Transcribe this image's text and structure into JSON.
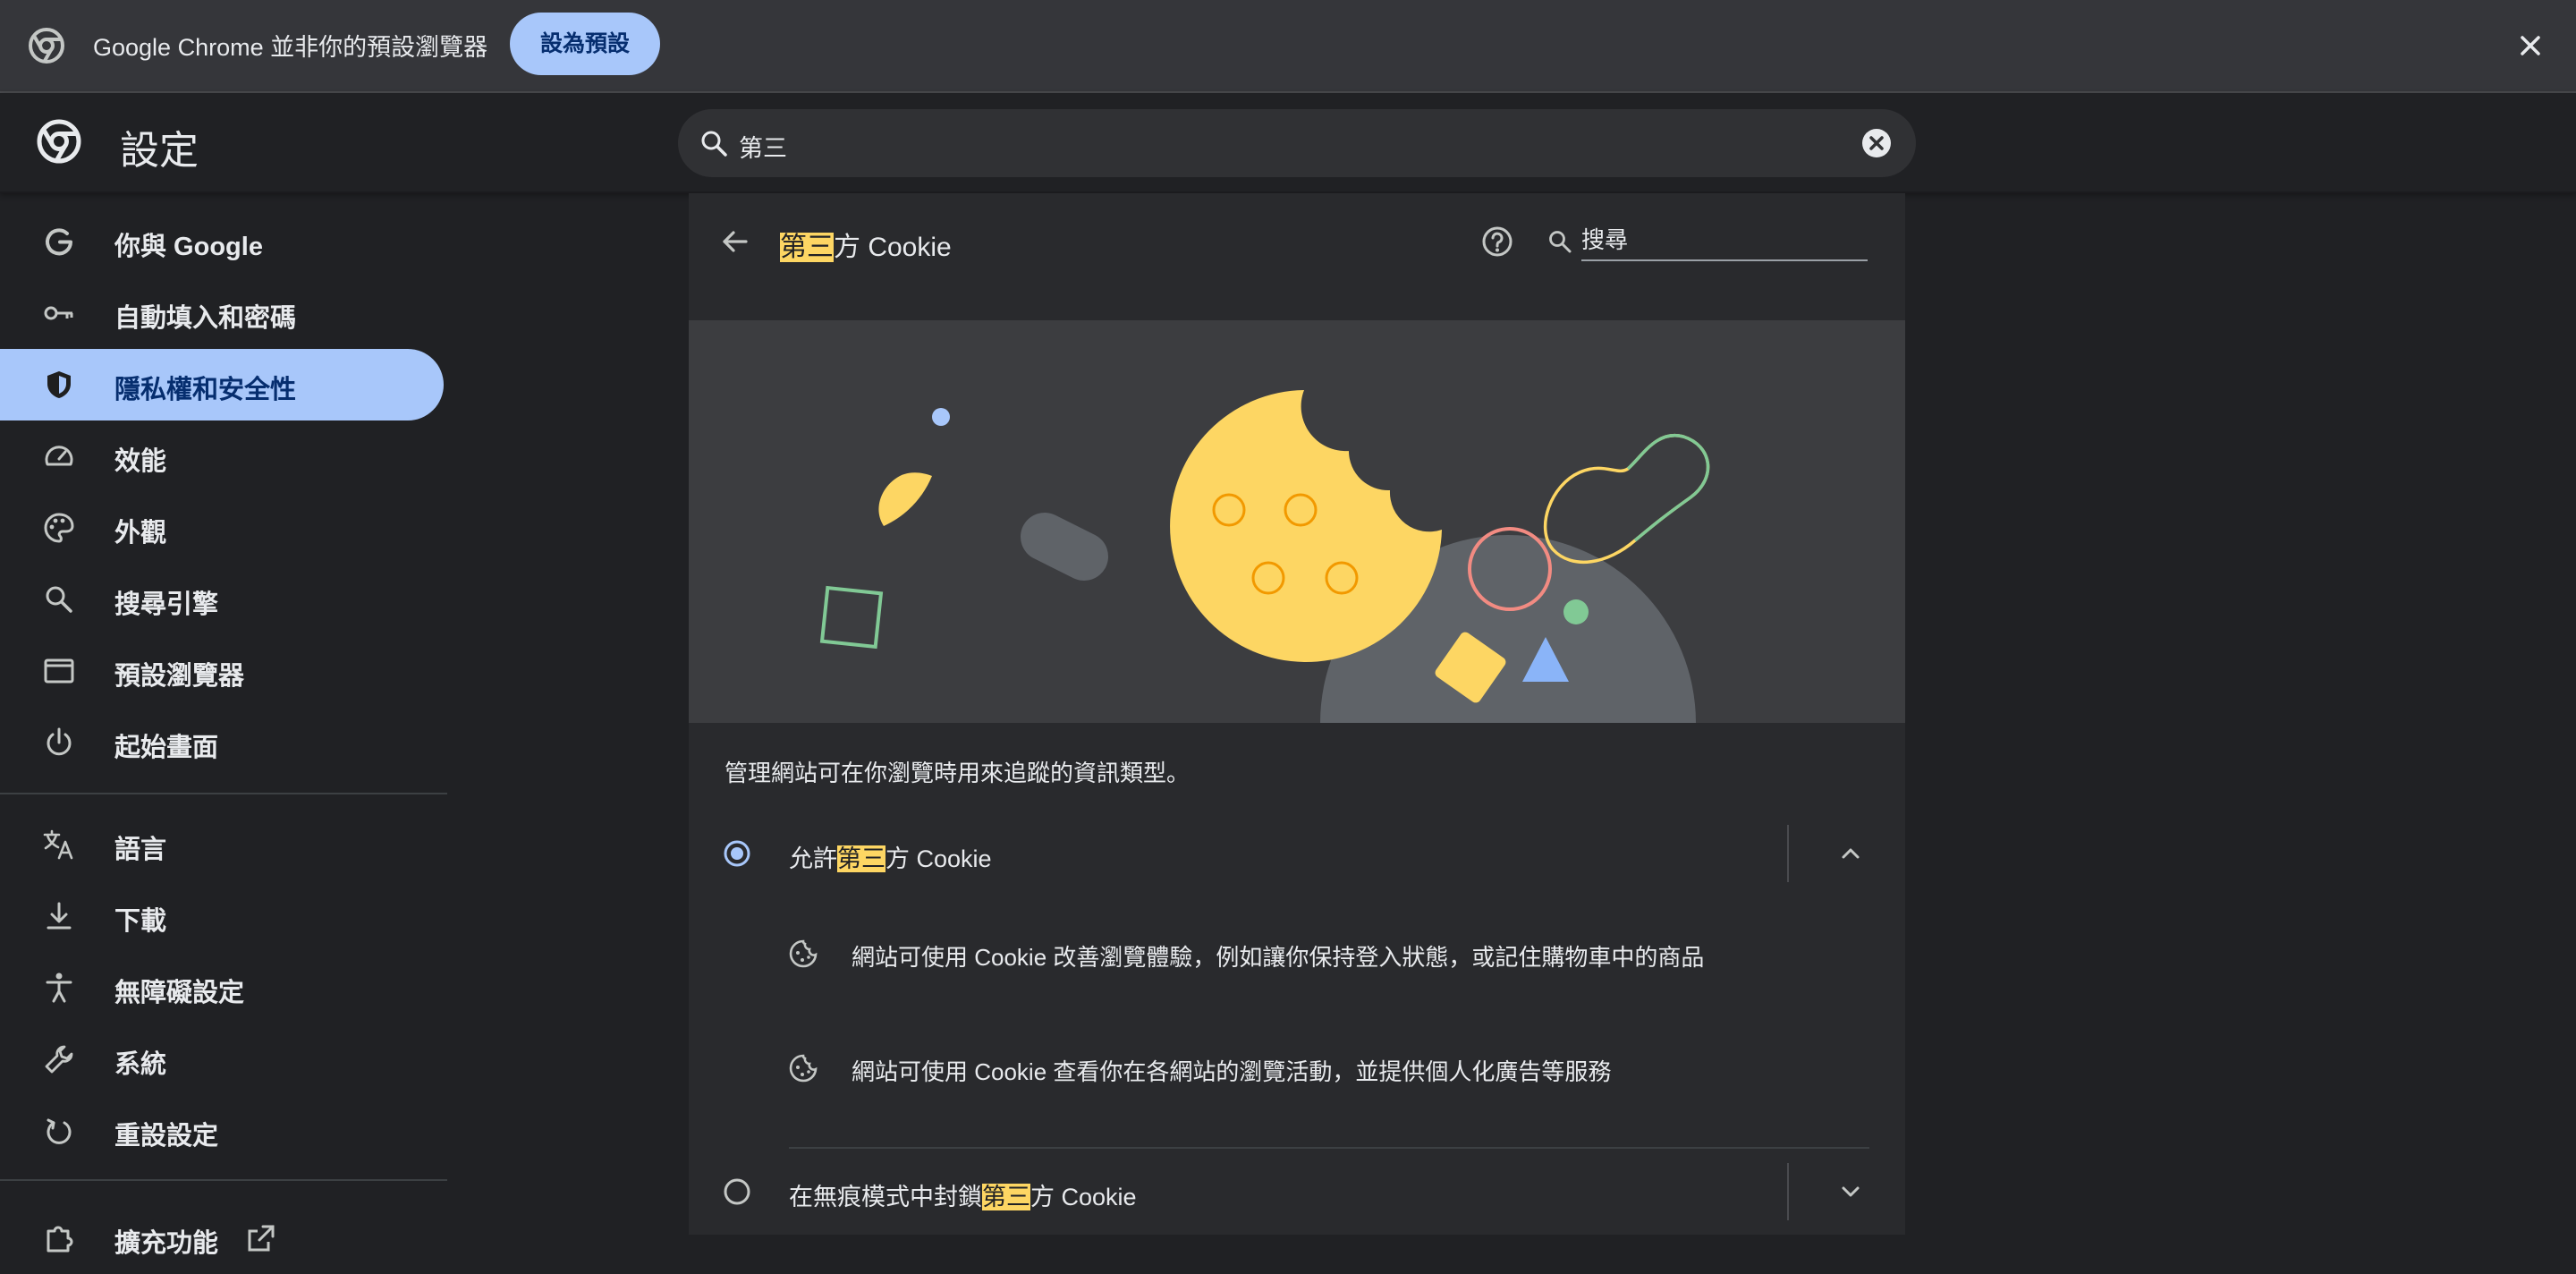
{
  "infobar": {
    "message": "Google Chrome 並非你的預設瀏覽器",
    "button": "設為預設"
  },
  "header": {
    "title": "設定",
    "search_value": "第三"
  },
  "sidebar": {
    "items": [
      {
        "label": "你與 Google",
        "icon": "google-g-icon"
      },
      {
        "label": "自動填入和密碼",
        "icon": "key-icon"
      },
      {
        "label": "隱私權和安全性",
        "icon": "shield-icon",
        "active": true
      },
      {
        "label": "效能",
        "icon": "speedometer-icon"
      },
      {
        "label": "外觀",
        "icon": "palette-icon"
      },
      {
        "label": "搜尋引擎",
        "icon": "search-icon"
      },
      {
        "label": "預設瀏覽器",
        "icon": "browser-window-icon"
      },
      {
        "label": "起始畫面",
        "icon": "power-icon"
      },
      {
        "label": "語言",
        "icon": "translate-icon"
      },
      {
        "label": "下載",
        "icon": "download-icon"
      },
      {
        "label": "無障礙設定",
        "icon": "accessibility-icon"
      },
      {
        "label": "系統",
        "icon": "wrench-icon"
      },
      {
        "label": "重設設定",
        "icon": "reset-icon"
      },
      {
        "label": "擴充功能",
        "icon": "extension-icon"
      }
    ]
  },
  "panel": {
    "title_highlight": "第三",
    "title_rest": "方 Cookie",
    "search_placeholder": "搜尋",
    "description": "管理網站可在你瀏覽時用來追蹤的資訊類型。",
    "options": [
      {
        "label_pre": "允許",
        "label_highlight": "第三",
        "label_post": "方 Cookie",
        "selected": true,
        "expanded": true,
        "bullets": [
          "網站可使用 Cookie 改善瀏覽體驗，例如讓你保持登入狀態，或記住購物車中的商品",
          "網站可使用 Cookie 查看你在各網站的瀏覽活動，並提供個人化廣告等服務"
        ]
      },
      {
        "label_pre": "在無痕模式中封鎖",
        "label_highlight": "第三",
        "label_post": "方 Cookie",
        "selected": false,
        "expanded": false
      }
    ]
  },
  "colors": {
    "accent": "#a8c7fa",
    "highlight": "#fdd663",
    "background": "#202124",
    "panel": "#292a2d"
  }
}
